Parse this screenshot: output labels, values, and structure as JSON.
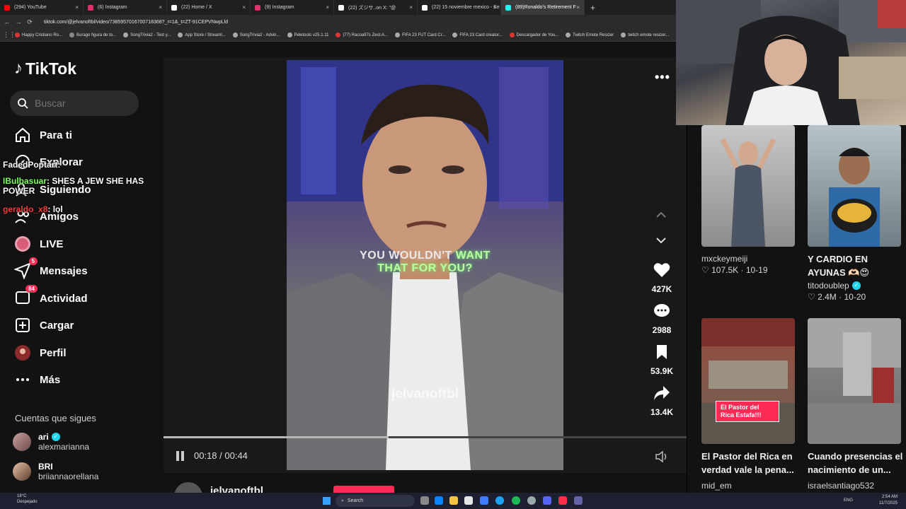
{
  "browser": {
    "tabs": [
      {
        "label": "(294) YouTube",
        "color": "#ff0000",
        "active": false
      },
      {
        "label": "(6) Instagram",
        "color": "#e1306c",
        "active": false
      },
      {
        "label": "(22) Home / X",
        "color": "#ffffff",
        "active": false
      },
      {
        "label": "(9) Instagram",
        "color": "#e1306c",
        "active": false
      },
      {
        "label": "(22) ズジサ..on X: \"@",
        "color": "#ffffff",
        "active": false
      },
      {
        "label": "(22) 15 noviembre mexico - Se",
        "color": "#ffffff",
        "active": false
      },
      {
        "label": "(89)Ronaldo's Retirement F",
        "color": "#25f4ee",
        "active": true
      }
    ],
    "new_tab": "+",
    "url": "tiktok.com/@jelvanoftbl/video/7385957016700718368?_r=1&_t=ZT-91CEPVNwpLld",
    "bookmarks": [
      {
        "label": "Happy Cristiano Ro...",
        "color": "#d33"
      },
      {
        "label": "Burago figura de to...",
        "color": "#888"
      },
      {
        "label": "SongTrivia2 - Test y...",
        "color": "#aaa"
      },
      {
        "label": "App Store / Streaml...",
        "color": "#aaa"
      },
      {
        "label": "SongTrivia2 - Advin...",
        "color": "#aaa"
      },
      {
        "label": "Peletools v25.1.11",
        "color": "#aaa"
      },
      {
        "label": "(77) Racoa97s Zest-A...",
        "color": "#d33"
      },
      {
        "label": "FIFA 23 FUT Card Cr...",
        "color": "#aaa"
      },
      {
        "label": "FIFA 23 Card creator...",
        "color": "#aaa"
      },
      {
        "label": "Descargador de You...",
        "color": "#d33"
      },
      {
        "label": "Twitch Emote Resizer",
        "color": "#aaa"
      },
      {
        "label": "twitch emote resizer...",
        "color": "#aaa"
      }
    ]
  },
  "sidebar": {
    "logo": "TikTok",
    "search_placeholder": "Buscar",
    "nav": [
      {
        "label": "Para ti",
        "icon": "home-icon",
        "badge": ""
      },
      {
        "label": "Explorar",
        "icon": "compass-icon",
        "badge": ""
      },
      {
        "label": "Siguiendo",
        "icon": "following-icon",
        "badge": ""
      },
      {
        "label": "Amigos",
        "icon": "friends-icon",
        "badge": ""
      },
      {
        "label": "LIVE",
        "icon": "live-icon",
        "badge": ""
      },
      {
        "label": "Mensajes",
        "icon": "messages-icon",
        "badge": "5"
      },
      {
        "label": "Actividad",
        "icon": "activity-icon",
        "badge": "84"
      },
      {
        "label": "Cargar",
        "icon": "upload-icon",
        "badge": ""
      },
      {
        "label": "Perfil",
        "icon": "profile-icon",
        "badge": ""
      },
      {
        "label": "Más",
        "icon": "more-icon",
        "badge": ""
      }
    ],
    "following_title": "Cuentas que sigues",
    "accounts": [
      {
        "name": "ari",
        "handle": "alexmarianna",
        "verified": true
      },
      {
        "name": "BRI",
        "handle": "briiannaorellana",
        "verified": false
      }
    ]
  },
  "chat": [
    {
      "user": "FadedPoptart",
      "message": ":",
      "color": "#ffffff"
    },
    {
      "user": "IBulbasuar",
      "message": ": SHES A JEW SHE HAS POWER",
      "color": "#7dff5a"
    },
    {
      "user": "geraldo_x8",
      "message": ": lol",
      "color": "#ff3c3c"
    }
  ],
  "video": {
    "caption_line1_a": "YOU WOULDN'T ",
    "caption_line1_b": "WANT",
    "caption_line2": "THAT FOR YOU?",
    "watermark": "jelvanoftbl",
    "time": "00:18 / 00:44",
    "progress": 0.43,
    "author": "jelvanoftbl",
    "actions": [
      {
        "icon": "heart-icon",
        "count": "427K"
      },
      {
        "icon": "comment-icon",
        "count": "2988"
      },
      {
        "icon": "bookmark-icon",
        "count": "53.9K"
      },
      {
        "icon": "share-icon",
        "count": "13.4K"
      }
    ]
  },
  "recommended": [
    {
      "title": "",
      "user": "mxckeymeiji",
      "verified": false,
      "likes": "107.5K",
      "date": "10-19",
      "tag": ""
    },
    {
      "title": "Y CARDIO EN AYUNAS 🫶🏻😍",
      "user": "titodoublep",
      "verified": true,
      "likes": "2.4M",
      "date": "10-20",
      "tag": ""
    },
    {
      "title": "El Pastor del Rica en verdad vale la pena...",
      "user": "mid_em",
      "verified": false,
      "likes": "",
      "date": "",
      "tag": "El Pastor del Rica Estafa!!!"
    },
    {
      "title": "Cuando presencias el nacimiento de un...",
      "user": "israelsantiago532",
      "verified": false,
      "likes": "",
      "date": "",
      "tag": ""
    }
  ],
  "taskbar": {
    "weather_temp": "18°C",
    "weather_desc": "Despejado",
    "search": "Search",
    "lang": "ENG",
    "time": "2:54 AM",
    "date": "11/7/2025"
  }
}
